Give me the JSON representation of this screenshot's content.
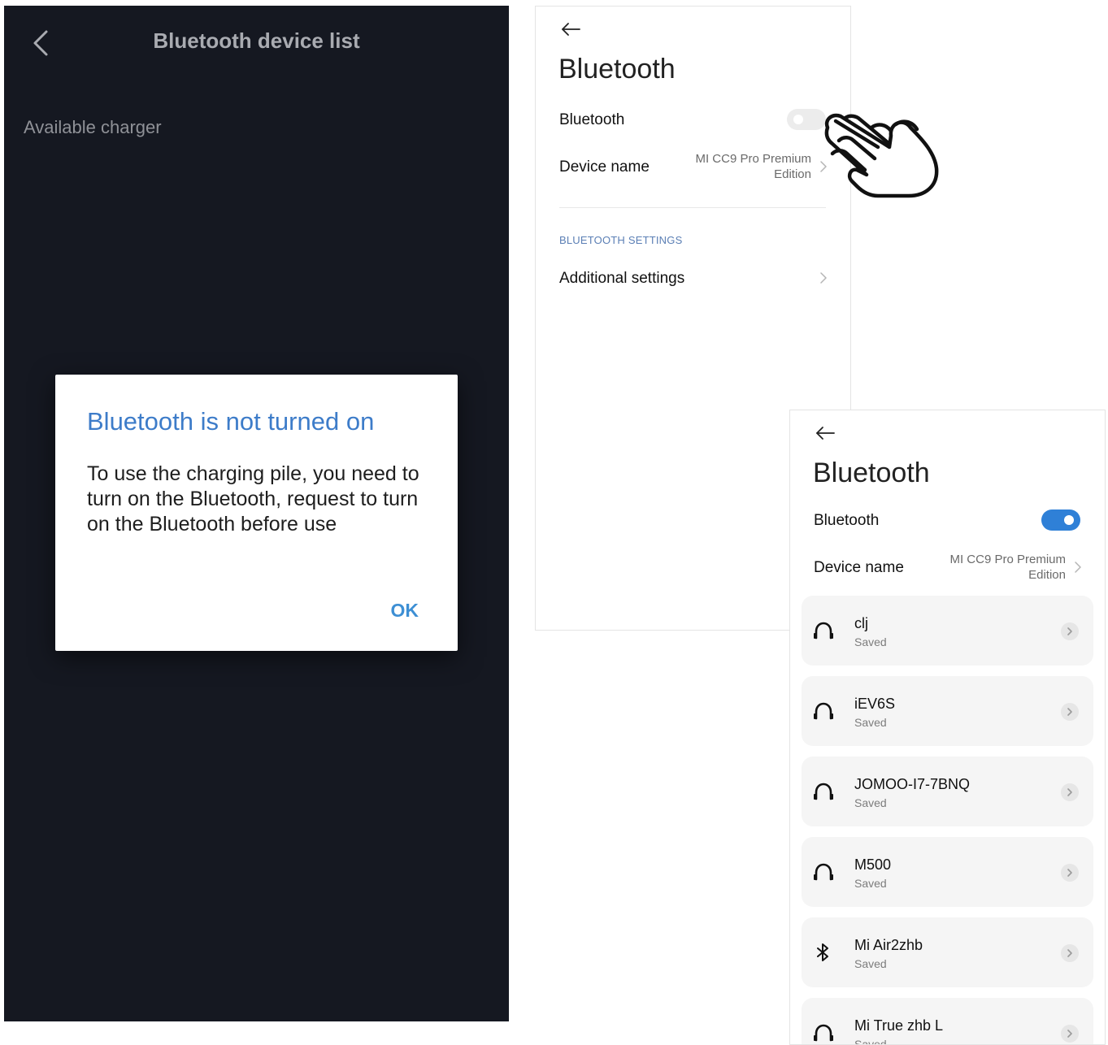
{
  "left_screen": {
    "title": "Bluetooth device list",
    "section_label": "Available charger",
    "dialog": {
      "title": "Bluetooth is not turned on",
      "message": "To use the charging pile, you need to turn on the Bluetooth, request to turn on the Bluetooth before use",
      "ok_label": "OK"
    }
  },
  "settings_off": {
    "title": "Bluetooth",
    "bluetooth_label": "Bluetooth",
    "bluetooth_enabled": false,
    "device_name_label": "Device name",
    "device_name_value": "MI CC9 Pro Premium Edition",
    "section_header": "BLUETOOTH SETTINGS",
    "additional_settings_label": "Additional settings"
  },
  "settings_on": {
    "title": "Bluetooth",
    "bluetooth_label": "Bluetooth",
    "bluetooth_enabled": true,
    "device_name_label": "Device name",
    "device_name_value": "MI CC9 Pro Premium Edition",
    "devices": [
      {
        "name": "clj",
        "status": "Saved",
        "icon": "headphones-icon"
      },
      {
        "name": "iEV6S",
        "status": "Saved",
        "icon": "headphones-icon"
      },
      {
        "name": "JOMOO-I7-7BNQ",
        "status": "Saved",
        "icon": "headphones-icon"
      },
      {
        "name": "M500",
        "status": "Saved",
        "icon": "headphones-icon"
      },
      {
        "name": "Mi Air2zhb",
        "status": "Saved",
        "icon": "bluetooth-icon"
      },
      {
        "name": "Mi True zhb L",
        "status": "Saved",
        "icon": "headphones-icon"
      }
    ]
  },
  "colors": {
    "dark_bg": "#151821",
    "dialog_title": "#3d7cc9",
    "toggle_on": "#2f80d7",
    "section_header": "#5b7fb5"
  }
}
